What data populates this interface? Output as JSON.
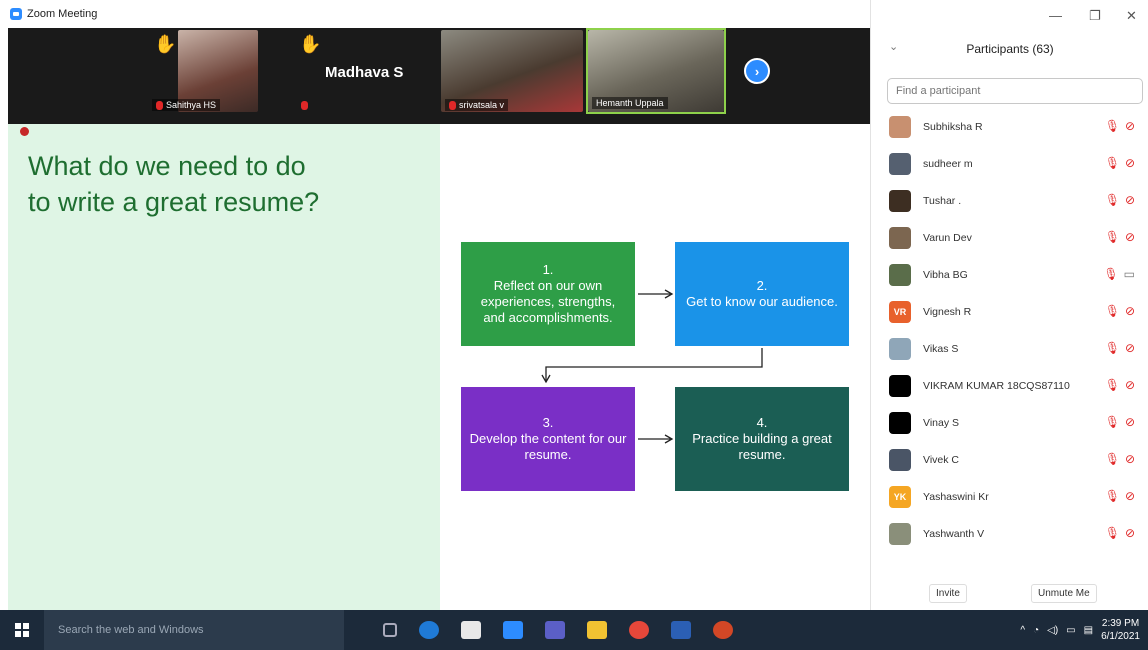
{
  "window": {
    "title": "Zoom Meeting"
  },
  "gallery": {
    "tiles": [
      {
        "name": "Sahithya HS"
      },
      {
        "name": "Madhava S"
      },
      {
        "name": "srivatsala v"
      },
      {
        "name": "Hemanth Uppala"
      }
    ]
  },
  "slide": {
    "heading": "What do we need to do to write a great resume?",
    "boxes": [
      {
        "text": "1.\nReflect on our own experiences, strengths, and accomplishments.",
        "color": "#2e9e47"
      },
      {
        "text": "2.\nGet to know our audience.",
        "color": "#1a93e8"
      },
      {
        "text": "3.\nDevelop the content for our resume.",
        "color": "#7a2fc6"
      },
      {
        "text": "4.\nPractice building a great resume.",
        "color": "#1b5e54"
      }
    ]
  },
  "participants": {
    "title": "Participants (63)",
    "search_placeholder": "Find a participant",
    "list": [
      {
        "name": "Subhiksha R",
        "avatar": "",
        "avatar_color": "#c89070",
        "video_off": true
      },
      {
        "name": "sudheer m",
        "avatar": "",
        "avatar_color": "#556070",
        "video_off": true
      },
      {
        "name": "Tushar .",
        "avatar": "",
        "avatar_color": "#3d2e22",
        "video_off": true
      },
      {
        "name": "Varun Dev",
        "avatar": "",
        "avatar_color": "#7c6650",
        "video_off": true
      },
      {
        "name": "Vibha BG",
        "avatar": "",
        "avatar_color": "#5a6d4a",
        "video_off": false
      },
      {
        "name": "Vignesh R",
        "avatar": "VR",
        "avatar_color": "#e8612c",
        "video_off": true
      },
      {
        "name": "Vikas S",
        "avatar": "",
        "avatar_color": "#8fa6b8",
        "video_off": true
      },
      {
        "name": "VIKRAM KUMAR 18CQS87110",
        "avatar": "",
        "avatar_color": "#000000",
        "video_off": true
      },
      {
        "name": "Vinay S",
        "avatar": "",
        "avatar_color": "#000000",
        "video_off": true
      },
      {
        "name": "Vivek C",
        "avatar": "",
        "avatar_color": "#4a5566",
        "video_off": true
      },
      {
        "name": "Yashaswini Kr",
        "avatar": "YK",
        "avatar_color": "#f5a623",
        "video_off": true
      },
      {
        "name": "Yashwanth V",
        "avatar": "",
        "avatar_color": "#8a8f7a",
        "video_off": true
      }
    ],
    "invite_label": "Invite",
    "unmute_label": "Unmute Me"
  },
  "taskbar": {
    "search_text": "Search the web and Windows",
    "time": "2:39 PM",
    "date": "6/1/2021"
  }
}
